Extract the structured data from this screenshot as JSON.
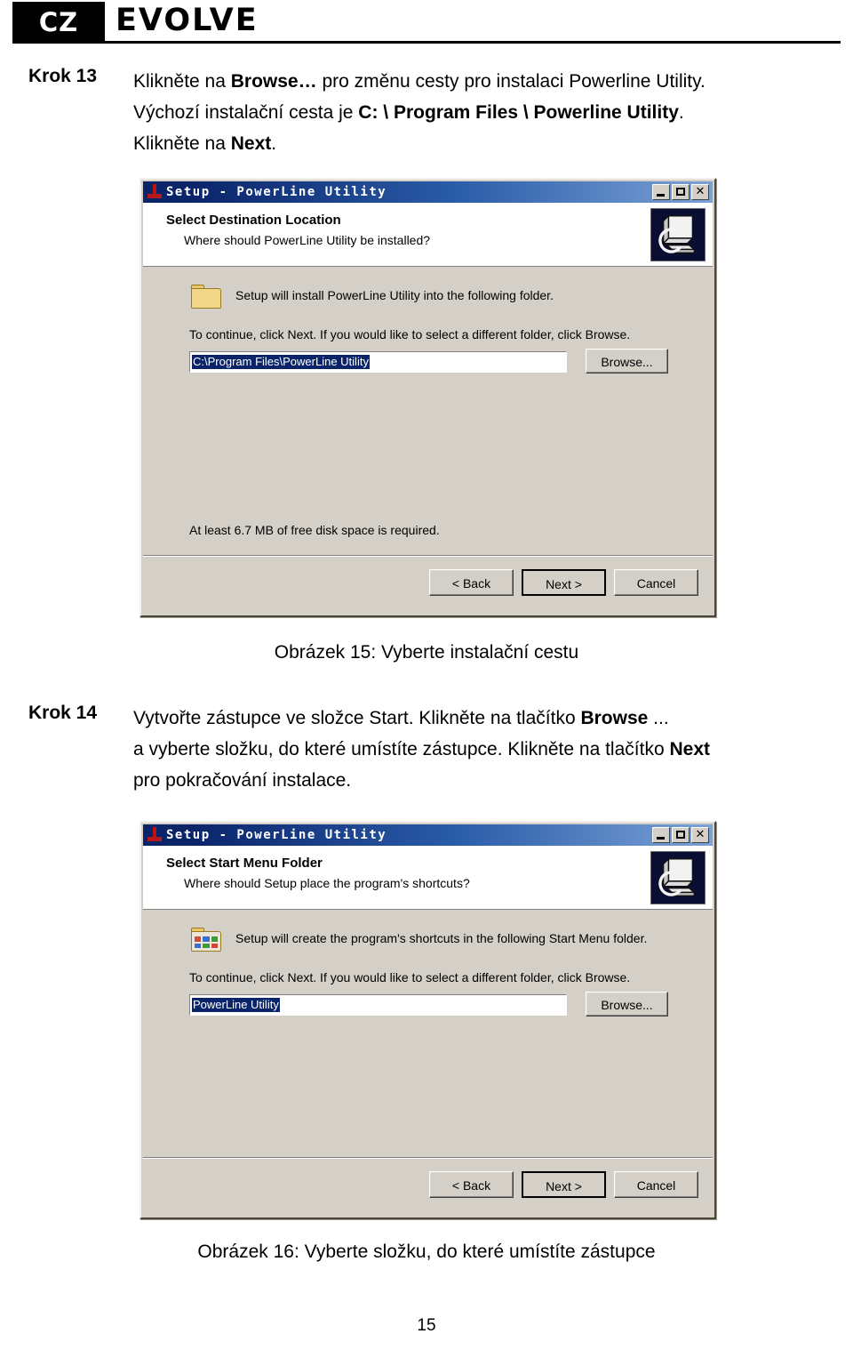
{
  "brand": {
    "badge": "CZ",
    "name": "EVOLVE"
  },
  "steps": [
    {
      "label": "Krok 13",
      "lines": [
        {
          "pre": "Klikněte na ",
          "bold": "Browse…",
          "post": " pro změnu cesty pro instalaci Powerline Utility."
        },
        {
          "pre": "Výchozí instalační cesta je ",
          "bold": "C: \\ Program Files \\ Powerline Utility",
          "post": "."
        },
        {
          "pre": "Klikněte na ",
          "bold": "Next",
          "post": "."
        }
      ]
    },
    {
      "label": "Krok 14",
      "lines": [
        {
          "pre": "Vytvořte zástupce ve složce Start. Klikněte na tlačítko ",
          "bold": "Browse",
          "post": " ..."
        },
        {
          "pre": "a vyberte složku, do které umístíte zástupce. Klikněte na tlačítko ",
          "bold": "Next",
          "post": ""
        },
        {
          "pre": "pro pokračování instalace.",
          "bold": "",
          "post": ""
        }
      ]
    }
  ],
  "captions": {
    "figure15": "Obrázek 15: Vyberte instalační cestu",
    "figure16": "Obrázek 16: Vyberte složku, do které umístíte zástupce"
  },
  "page_number": "15",
  "dialogs": [
    {
      "id": "destination",
      "titlebar": {
        "title": "Setup - PowerLine Utility",
        "icon": "setup-pin-icon",
        "minimize_label": "Minimize",
        "maximize_label": "Maximize",
        "close_label": "✕"
      },
      "header": {
        "title": "Select Destination Location",
        "subtitle": "Where should PowerLine Utility be installed?",
        "icon": "computer-install-icon"
      },
      "body": {
        "icon": "folder-icon",
        "line1": "Setup will install PowerLine Utility into the following folder.",
        "line2": "To continue, click Next. If you would like to select a different folder, click Browse.",
        "input_value": "C:\\Program Files\\PowerLine Utility",
        "browse_label": "Browse...",
        "disk_note": "At least 6.7 MB of free disk space is required."
      },
      "footer": {
        "back_label": "< Back",
        "next_label": "Next >",
        "cancel_label": "Cancel"
      }
    },
    {
      "id": "startmenu",
      "titlebar": {
        "title": "Setup - PowerLine Utility",
        "icon": "setup-pin-icon",
        "minimize_label": "Minimize",
        "maximize_label": "Maximize",
        "close_label": "✕"
      },
      "header": {
        "title": "Select Start Menu Folder",
        "subtitle": "Where should Setup place the program's shortcuts?",
        "icon": "computer-install-icon"
      },
      "body": {
        "icon": "start-menu-folder-icon",
        "line1": "Setup will create the program's shortcuts in the following Start Menu folder.",
        "line2": "To continue, click Next. If you would like to select a different folder, click Browse.",
        "input_value": "PowerLine Utility",
        "browse_label": "Browse...",
        "disk_note": ""
      },
      "footer": {
        "back_label": "< Back",
        "next_label": "Next >",
        "cancel_label": "Cancel"
      }
    }
  ],
  "colors": {
    "titlebar_start": "#0a246a",
    "titlebar_end": "#7ba2d8",
    "dialog_face": "#d4d0c8",
    "selection": "#0a246a",
    "brand_black": "#000000"
  }
}
